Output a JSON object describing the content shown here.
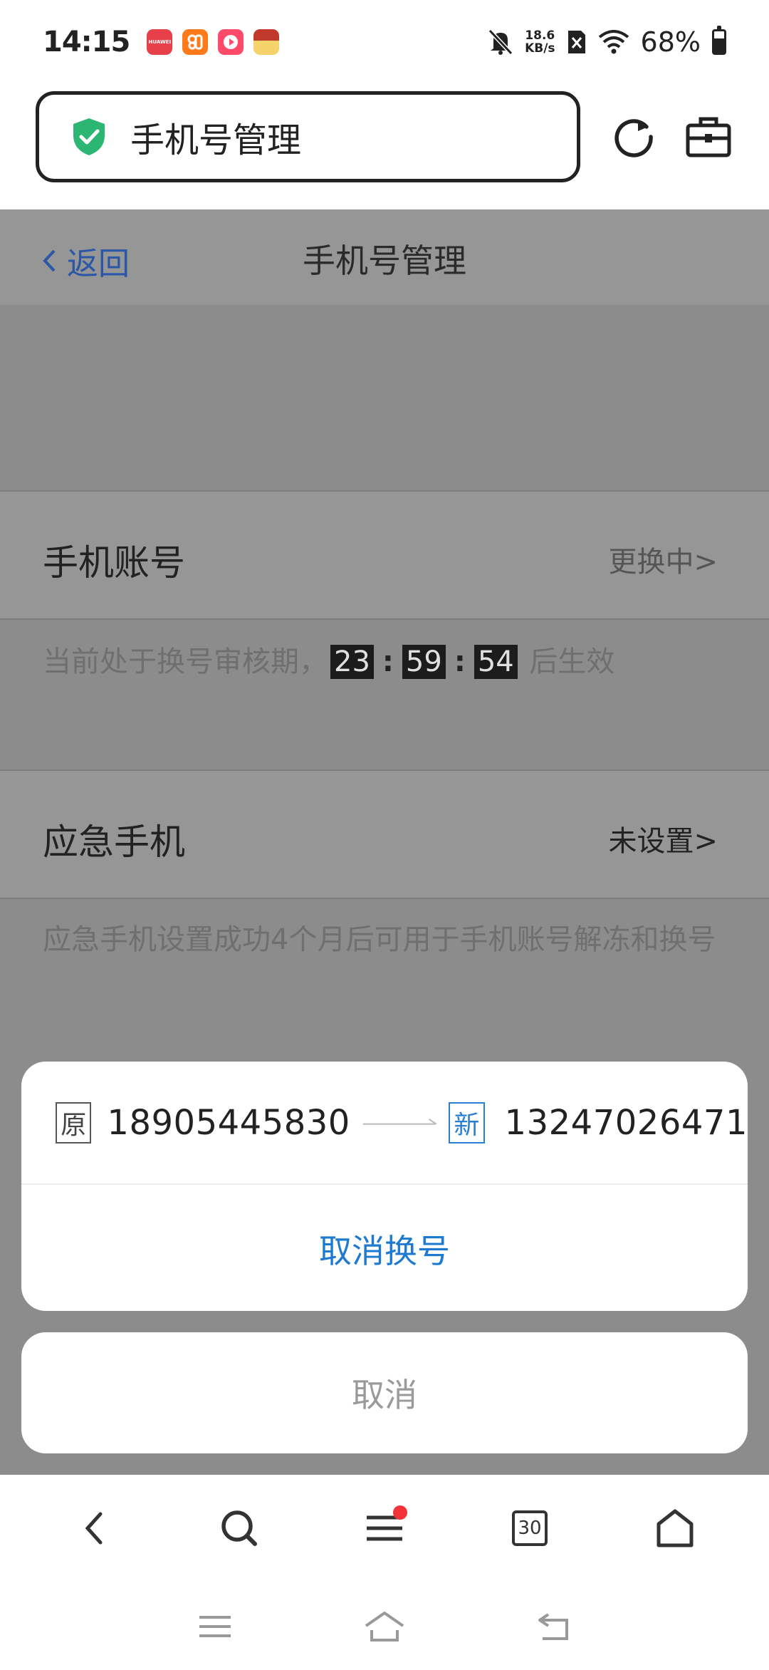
{
  "status": {
    "time": "14:15",
    "net_speed_value": "18.6",
    "net_speed_unit": "KB/s",
    "battery": "68%",
    "apps": [
      {
        "name": "huawei-app",
        "label": "HUAWEI",
        "color": "#e8404a"
      },
      {
        "name": "orange-app",
        "label": "",
        "color": "#ff7a1a"
      },
      {
        "name": "video-app",
        "label": "",
        "color": "#ff4a6a"
      },
      {
        "name": "game-app",
        "label": "",
        "color": "#f2b630"
      }
    ]
  },
  "browser": {
    "title": "手机号管理"
  },
  "page": {
    "back_label": "返回",
    "title": "手机号管理",
    "account_row": {
      "label": "手机账号",
      "value": "更换中>"
    },
    "review_note": {
      "prefix": "当前处于换号审核期，",
      "hours": "23",
      "minutes": "59",
      "seconds": "54",
      "suffix": "后生效"
    },
    "emergency_row": {
      "label": "应急手机",
      "value": "未设置>"
    },
    "emergency_note": "应急手机设置成功4个月后可用于手机账号解冻和换号"
  },
  "sheet": {
    "old_tag": "原",
    "old_number": "18905445830",
    "new_tag": "新",
    "new_number": "13247026471",
    "cancel_swap_label": "取消换号",
    "cancel_label": "取消"
  },
  "toolbar": {
    "tab_count": "30"
  },
  "colors": {
    "accent_blue": "#1d7ad0",
    "dim_overlay": "#8c8c8c",
    "shield_green": "#2bb673",
    "badge_red": "#f2333a"
  }
}
